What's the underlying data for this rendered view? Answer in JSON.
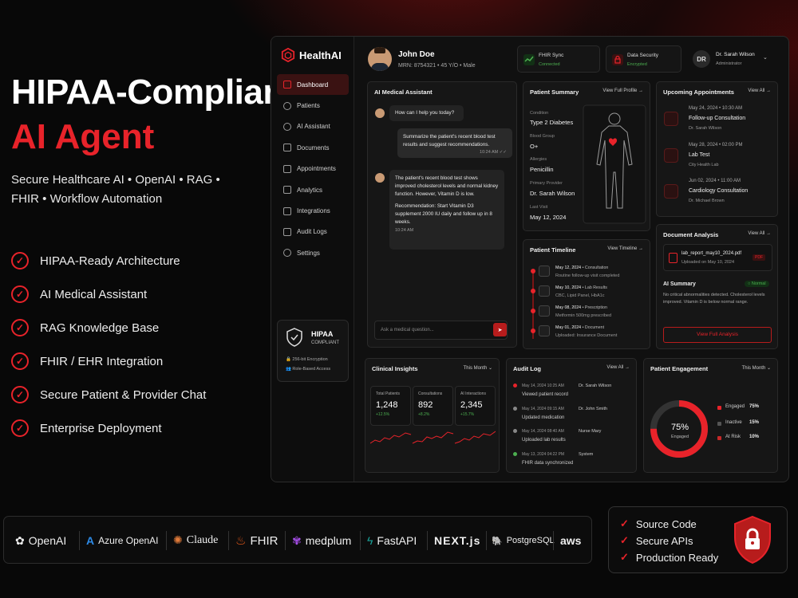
{
  "hero": {
    "title_line1": "HIPAA-Compliant",
    "title_line2": "AI Agent",
    "subtitle": "Secure Healthcare AI • OpenAI • RAG • FHIR • Workflow Automation"
  },
  "features": [
    "HIPAA-Ready Architecture",
    "AI Medical Assistant",
    "RAG Knowledge Base",
    "FHIR / EHR Integration",
    "Secure Patient & Provider Chat",
    "Enterprise Deployment"
  ],
  "app": {
    "name": "HealthAI"
  },
  "sidebar": {
    "items": [
      "Dashboard",
      "Patients",
      "AI Assistant",
      "Documents",
      "Appointments",
      "Analytics",
      "Integrations",
      "Audit Logs",
      "Settings"
    ],
    "hipaa_title": "HIPAA",
    "hipaa_sub": "COMPLIANT",
    "enc": "256-bit Encryption",
    "rbac": "Role-Based Access"
  },
  "header": {
    "patient_name": "John Doe",
    "patient_meta": "MRN: 8754321  •  45 Y/O  •  Male",
    "fhir_title": "FHIR Sync",
    "fhir_status": "Connected",
    "sec_title": "Data Security",
    "sec_status": "Encrypted",
    "user_initials": "DR",
    "user_name": "Dr. Sarah Wilson",
    "user_role": "Administrator"
  },
  "assistant": {
    "title": "AI Medical Assistant",
    "greeting": "How can I help you today?",
    "user_msg": "Summarize the patient's recent blood test results and suggest recommendations.",
    "user_time": "10:24 AM ✓✓",
    "ai_msg1": "The patient's recent blood test shows improved cholesterol levels and normal kidney function. However, Vitamin D is low.",
    "ai_msg2": "Recommendation: Start Vitamin D3 supplement 2000 IU daily and follow up in 8 weeks.",
    "ai_time": "10:24 AM",
    "input_placeholder": "Ask a medical question..."
  },
  "summary": {
    "title": "Patient Summary",
    "link": "View Full Profile →",
    "fields": [
      {
        "label": "Condition",
        "value": "Type 2 Diabetes"
      },
      {
        "label": "Blood Group",
        "value": "O+"
      },
      {
        "label": "Allergies",
        "value": "Penicillin"
      },
      {
        "label": "Primary Provider",
        "value": "Dr. Sarah Wilson"
      },
      {
        "label": "Last Visit",
        "value": "May 12, 2024"
      }
    ]
  },
  "appointments": {
    "title": "Upcoming Appointments",
    "link": "View All →",
    "items": [
      {
        "date": "May 24, 2024  •  10:30 AM",
        "title": "Follow-up Consultation",
        "who": "Dr. Sarah Wilson"
      },
      {
        "date": "May 28, 2024  •  02:00 PM",
        "title": "Lab Test",
        "who": "City Health Lab"
      },
      {
        "date": "Jun 02, 2024  •  11:00 AM",
        "title": "Cardiology Consultation",
        "who": "Dr. Michael Brown"
      }
    ]
  },
  "timeline": {
    "title": "Patient Timeline",
    "link": "View Timeline →",
    "items": [
      {
        "date": "May 12, 2024",
        "type": "Consultation",
        "text": "Routine follow-up visit completed"
      },
      {
        "date": "May 10, 2024",
        "type": "Lab Results",
        "text": "CBC, Lipid Panel, HbA1c"
      },
      {
        "date": "May 08, 2024",
        "type": "Prescription",
        "text": "Metformin 500mg prescribed"
      },
      {
        "date": "May 01, 2024",
        "type": "Document",
        "text": "Uploaded: Insurance Document"
      }
    ]
  },
  "doc": {
    "title": "Document Analysis",
    "link": "View All →",
    "file": "lab_report_may10_2024.pdf",
    "uploaded": "Uploaded on May 10, 2024",
    "pdf": "PDF",
    "ai_summary": "AI Summary",
    "status": "○ Normal",
    "text": "No critical abnormalities detected. Cholesterol levels improved. Vitamin D is below normal range.",
    "button": "View Full Analysis"
  },
  "insights": {
    "title": "Clinical Insights",
    "period": "This Month ⌄",
    "stats": [
      {
        "label": "Total Patients",
        "value": "1,248",
        "change": "+12.5%"
      },
      {
        "label": "Consultations",
        "value": "892",
        "change": "+8.2%"
      },
      {
        "label": "AI Interactions",
        "value": "2,345",
        "change": "+15.7%"
      }
    ]
  },
  "audit": {
    "title": "Audit Log",
    "link": "View All →",
    "items": [
      {
        "time": "May 14, 2024 10:25 AM",
        "user": "Dr. Sarah Wilson",
        "action": "Viewed patient record",
        "color": "#e8232a"
      },
      {
        "time": "May 14, 2024 09:15 AM",
        "user": "Dr. John Smith",
        "action": "Updated medication",
        "color": "#888888"
      },
      {
        "time": "May 14, 2024 08:40 AM",
        "user": "Nurse Mary",
        "action": "Uploaded lab results",
        "color": "#888888"
      },
      {
        "time": "May 13, 2024 04:22 PM",
        "user": "System",
        "action": "FHIR data synchronized",
        "color": "#4caf50"
      }
    ]
  },
  "engagement": {
    "title": "Patient Engagement",
    "period": "This Month ⌄",
    "center_value": "75%",
    "center_label": "Engaged",
    "legend": [
      {
        "label": "Engaged",
        "value": "75%",
        "color": "#e8232a"
      },
      {
        "label": "Inactive",
        "value": "15%",
        "color": "#555555"
      },
      {
        "label": "At Risk",
        "value": "10%",
        "color": "#c62828"
      }
    ]
  },
  "tech": [
    "OpenAI",
    "Azure OpenAI",
    "Claude",
    "FHIR",
    "medplum",
    "FastAPI",
    "NEXT.js",
    "PostgreSQL",
    "aws"
  ],
  "deliverables": [
    "Source Code",
    "Secure APIs",
    "Production Ready"
  ],
  "colors": {
    "accent": "#e8232a",
    "positive": "#4caf50"
  }
}
